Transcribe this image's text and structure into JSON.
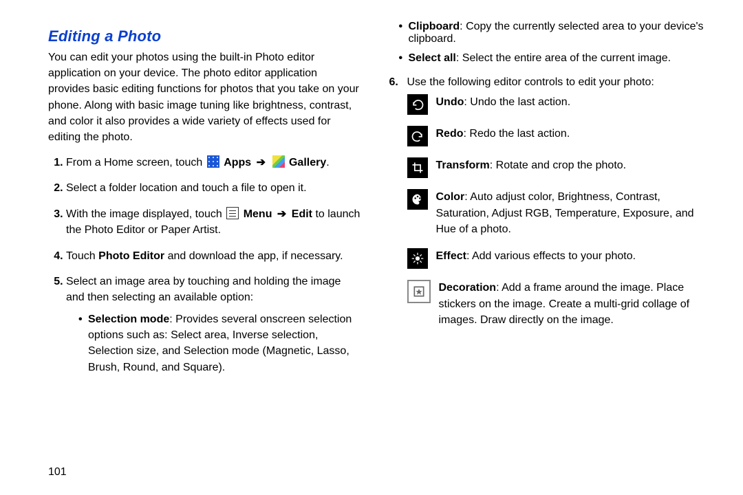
{
  "title": "Editing a Photo",
  "intro": "You can edit your photos using the built-in Photo editor application on your device. The photo editor application provides basic editing functions for photos that you take on your phone. Along with basic image tuning like brightness, contrast, and color it also provides a wide variety of effects used for editing the photo.",
  "step1": {
    "pre": "From a Home screen, touch ",
    "apps": "Apps",
    "gallery": "Gallery",
    "post": "."
  },
  "step2": "Select a folder location and touch a file to open it.",
  "step3": {
    "pre": "With the image displayed, touch ",
    "menu": "Menu",
    "edit": "Edit",
    "post": " to launch the Photo Editor or Paper Artist."
  },
  "step4": {
    "pre": "Touch ",
    "bold": "Photo Editor",
    "post": " and download the app, if necessary."
  },
  "step5": {
    "intro": "Select an image area by touching and holding the image and then selecting an available option:"
  },
  "step5_selmode": {
    "label": "Selection mode",
    "text": ": Provides several onscreen selection options such as: Select area, Inverse selection, Selection size, and Selection mode (Magnetic, Lasso, Brush, Round, and Square)."
  },
  "step5_clipboard": {
    "label": "Clipboard",
    "text": ": Copy the currently selected area to your device's clipboard."
  },
  "step5_selectall": {
    "label": "Select all",
    "text": ": Select the entire area of the current image."
  },
  "step6": {
    "num": "6.",
    "text": "Use the following editor controls to edit your photo:"
  },
  "controls": {
    "undo": {
      "label": "Undo",
      "text": ": Undo the last action."
    },
    "redo": {
      "label": "Redo",
      "text": ": Redo the last action."
    },
    "transform": {
      "label": "Transform",
      "text": ": Rotate and crop the photo."
    },
    "color": {
      "label": "Color",
      "text": ": Auto adjust color, Brightness, Contrast, Saturation, Adjust RGB, Temperature, Exposure, and Hue of a photo."
    },
    "effect": {
      "label": "Effect",
      "text": ": Add various effects to your photo."
    },
    "decoration": {
      "label": "Decoration",
      "text": ": Add a frame around the image. Place stickers on the image. Create a multi-grid collage of images. Draw directly on the image."
    }
  },
  "page_number": "101"
}
